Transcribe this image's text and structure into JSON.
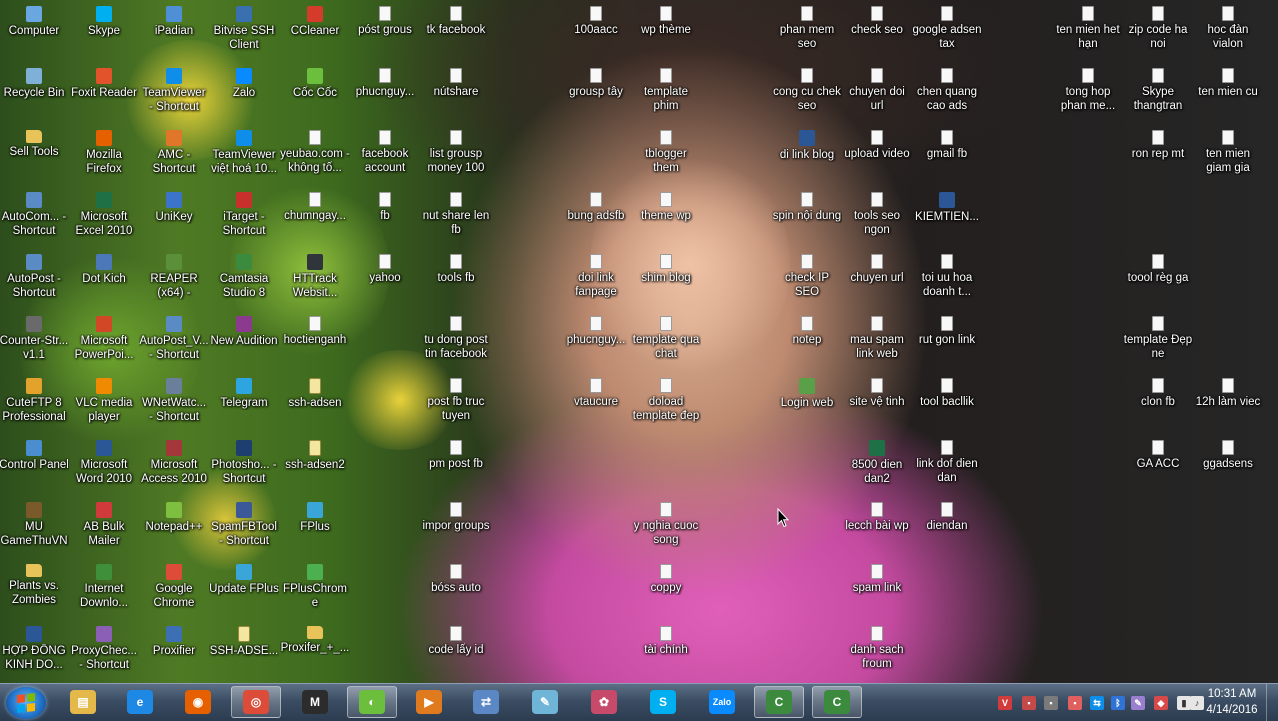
{
  "desktop_icons": [
    {
      "label": "Computer",
      "icon": "computer-icon",
      "color": "#6aa7e0"
    },
    {
      "label": "Skype",
      "icon": "skype-icon",
      "color": "#00aff0"
    },
    {
      "label": "iPadian",
      "icon": "ipadian-icon",
      "color": "#4f8fd6"
    },
    {
      "label": "Bitvise SSH Client",
      "icon": "bitvise-icon",
      "color": "#3a6fb0"
    },
    {
      "label": "CCleaner",
      "icon": "ccleaner-icon",
      "color": "#d43b2a"
    },
    {
      "label": "póst grous",
      "icon": "file-icon",
      "color": "#ffffff"
    },
    {
      "label": "tk facebook",
      "icon": "file-icon",
      "color": "#ffffff"
    },
    {
      "label": "100aacc",
      "icon": "file-icon",
      "color": "#ffffff"
    },
    {
      "label": "wp thème",
      "icon": "file-icon",
      "color": "#ffffff"
    },
    {
      "label": "phan mem seo",
      "icon": "file-icon",
      "color": "#ffffff"
    },
    {
      "label": "check seo",
      "icon": "file-icon",
      "color": "#ffffff"
    },
    {
      "label": "google adsen tax",
      "icon": "file-icon",
      "color": "#ffffff"
    },
    {
      "label": "ten mien het hạn",
      "icon": "file-icon",
      "color": "#ffffff"
    },
    {
      "label": "zip code ha noi",
      "icon": "file-icon",
      "color": "#ffffff"
    },
    {
      "label": "hoc đàn vialon",
      "icon": "file-icon",
      "color": "#ffffff"
    },
    {
      "label": "Recycle Bin",
      "icon": "recycle-bin-icon",
      "color": "#7fb0d8"
    },
    {
      "label": "Foxit Reader",
      "icon": "foxit-reader-icon",
      "color": "#e2522b"
    },
    {
      "label": "TeamViewer - Shortcut",
      "icon": "teamviewer-icon",
      "color": "#0e8ee9"
    },
    {
      "label": "Zalo",
      "icon": "zalo-icon",
      "color": "#0a8aff"
    },
    {
      "label": "Cốc Cốc",
      "icon": "coccoc-icon",
      "color": "#6bbf3c"
    },
    {
      "label": "phucnguy...",
      "icon": "file-icon",
      "color": "#ffffff"
    },
    {
      "label": "nútshare",
      "icon": "file-icon",
      "color": "#ffffff"
    },
    {
      "label": "grousp tây",
      "icon": "file-icon",
      "color": "#ffffff"
    },
    {
      "label": "template phim",
      "icon": "file-icon",
      "color": "#ffffff"
    },
    {
      "label": "cong cu chek seo",
      "icon": "file-icon",
      "color": "#ffffff"
    },
    {
      "label": "chuyen doi url",
      "icon": "file-icon",
      "color": "#ffffff"
    },
    {
      "label": "chen quang cao ads",
      "icon": "file-icon",
      "color": "#ffffff"
    },
    {
      "label": "tong hop phan me...",
      "icon": "file-icon",
      "color": "#ffffff"
    },
    {
      "label": "Skype thangtran",
      "icon": "file-icon",
      "color": "#ffffff"
    },
    {
      "label": "ten mien cu",
      "icon": "file-icon",
      "color": "#ffffff"
    },
    {
      "label": "Sell Tools",
      "icon": "folder-icon",
      "color": "#e8c35a"
    },
    {
      "label": "Mozilla Firefox",
      "icon": "firefox-icon",
      "color": "#e66000"
    },
    {
      "label": "AMC - Shortcut",
      "icon": "amc-icon",
      "color": "#e0762a"
    },
    {
      "label": "TeamViewer việt hoá 10...",
      "icon": "teamviewer-icon",
      "color": "#0e8ee9"
    },
    {
      "label": "yeubao.com - không tố...",
      "icon": "file-icon",
      "color": "#ffffff"
    },
    {
      "label": "facebook account",
      "icon": "file-icon",
      "color": "#ffffff"
    },
    {
      "label": "list grousp money 100",
      "icon": "file-icon",
      "color": "#ffffff"
    },
    {
      "label": "tblogger them",
      "icon": "file-icon",
      "color": "#ffffff"
    },
    {
      "label": "di link blog",
      "icon": "word-doc-icon",
      "color": "#2b5797"
    },
    {
      "label": "upload video",
      "icon": "file-icon",
      "color": "#ffffff"
    },
    {
      "label": "gmail fb",
      "icon": "file-icon",
      "color": "#ffffff"
    },
    {
      "label": "ron rep mt",
      "icon": "file-icon",
      "color": "#ffffff"
    },
    {
      "label": "ten mien giam gia",
      "icon": "file-icon",
      "color": "#ffffff"
    },
    {
      "label": "AutoCom... - Shortcut",
      "icon": "autocom-icon",
      "color": "#5a8bc4"
    },
    {
      "label": "Microsoft Excel 2010",
      "icon": "excel-icon",
      "color": "#1e7145"
    },
    {
      "label": "UniKey",
      "icon": "unikey-icon",
      "color": "#3c74c9"
    },
    {
      "label": "iTarget - Shortcut",
      "icon": "itarget-icon",
      "color": "#c8302c"
    },
    {
      "label": "chumngay...",
      "icon": "file-icon",
      "color": "#ffffff"
    },
    {
      "label": "fb",
      "icon": "file-icon",
      "color": "#ffffff"
    },
    {
      "label": "nut share len fb",
      "icon": "file-icon",
      "color": "#ffffff"
    },
    {
      "label": "bung adsfb",
      "icon": "file-icon",
      "color": "#ffffff"
    },
    {
      "label": "theme wp",
      "icon": "file-icon",
      "color": "#ffffff"
    },
    {
      "label": "spin nội dung",
      "icon": "file-icon",
      "color": "#ffffff"
    },
    {
      "label": "tools seo ngon",
      "icon": "file-icon",
      "color": "#ffffff"
    },
    {
      "label": "KIEMTIEN...",
      "icon": "word-doc-icon",
      "color": "#2b5797"
    },
    {
      "label": "AutoPost - Shortcut",
      "icon": "autopost-icon",
      "color": "#5a8bc4"
    },
    {
      "label": "Dot Kich",
      "icon": "dotkich-icon",
      "color": "#4c77b8"
    },
    {
      "label": "REAPER (x64) - Shortcut",
      "icon": "reaper-icon",
      "color": "#5b8f3a"
    },
    {
      "label": "Camtasia Studio 8",
      "icon": "camtasia-icon",
      "color": "#3b8a3e"
    },
    {
      "label": "HTTrack Websit...",
      "icon": "httrack-icon",
      "color": "#30353c"
    },
    {
      "label": "yahoo",
      "icon": "file-icon",
      "color": "#ffffff"
    },
    {
      "label": "tools fb",
      "icon": "file-icon",
      "color": "#ffffff"
    },
    {
      "label": "doi link fanpage",
      "icon": "file-icon",
      "color": "#ffffff"
    },
    {
      "label": "shim blog",
      "icon": "file-icon",
      "color": "#ffffff"
    },
    {
      "label": "check IP SEO",
      "icon": "file-icon",
      "color": "#ffffff"
    },
    {
      "label": "chuyen url",
      "icon": "file-icon",
      "color": "#ffffff"
    },
    {
      "label": "toi uu hoa doanh t...",
      "icon": "file-icon",
      "color": "#ffffff"
    },
    {
      "label": "toool règ ga",
      "icon": "file-icon",
      "color": "#ffffff"
    },
    {
      "label": "Counter-Str... v1.1",
      "icon": "counter-strike-icon",
      "color": "#6a6a6a"
    },
    {
      "label": "Microsoft PowerPoi...",
      "icon": "powerpoint-icon",
      "color": "#d24726"
    },
    {
      "label": "AutoPost_V... - Shortcut",
      "icon": "autopost-icon",
      "color": "#5a8bc4"
    },
    {
      "label": "New Audition",
      "icon": "audition-icon",
      "color": "#8b3a8f"
    },
    {
      "label": "hoctienganh",
      "icon": "file-icon",
      "color": "#ffffff"
    },
    {
      "label": "tu dong post tin facebook",
      "icon": "file-icon",
      "color": "#ffffff"
    },
    {
      "label": "phucnguy...",
      "icon": "file-icon",
      "color": "#ffffff"
    },
    {
      "label": "template qua chat",
      "icon": "file-icon",
      "color": "#ffffff"
    },
    {
      "label": "notep",
      "icon": "file-icon",
      "color": "#ffffff"
    },
    {
      "label": "mau spam link web",
      "icon": "file-icon",
      "color": "#ffffff"
    },
    {
      "label": "rut gon link",
      "icon": "file-icon",
      "color": "#ffffff"
    },
    {
      "label": "template Đẹp ne",
      "icon": "file-icon",
      "color": "#ffffff"
    },
    {
      "label": "CuteFTP 8 Professional",
      "icon": "cuteftp-icon",
      "color": "#e2a22c"
    },
    {
      "label": "VLC media player",
      "icon": "vlc-icon",
      "color": "#f08a00"
    },
    {
      "label": "WNetWatc... - Shortcut",
      "icon": "wnetwatcher-icon",
      "color": "#6a7f99"
    },
    {
      "label": "Telegram",
      "icon": "telegram-icon",
      "color": "#2ca5e0"
    },
    {
      "label": "ssh-adsen",
      "icon": "text-file-icon",
      "color": "#f2e6a0"
    },
    {
      "label": "post fb truc tuyen",
      "icon": "file-icon",
      "color": "#ffffff"
    },
    {
      "label": "vtaucure",
      "icon": "file-icon",
      "color": "#ffffff"
    },
    {
      "label": "doload template đep",
      "icon": "file-icon",
      "color": "#ffffff"
    },
    {
      "label": "Login web",
      "icon": "login-web-icon",
      "color": "#5aa048"
    },
    {
      "label": "site vệ tinh",
      "icon": "file-icon",
      "color": "#ffffff"
    },
    {
      "label": "tool bacllik",
      "icon": "file-icon",
      "color": "#ffffff"
    },
    {
      "label": "clon fb",
      "icon": "file-icon",
      "color": "#ffffff"
    },
    {
      "label": "12h làm viec",
      "icon": "file-icon",
      "color": "#ffffff"
    },
    {
      "label": "Control Panel",
      "icon": "control-panel-icon",
      "color": "#4a8ed0"
    },
    {
      "label": "Microsoft Word 2010",
      "icon": "word-icon",
      "color": "#2b5797"
    },
    {
      "label": "Microsoft Access 2010",
      "icon": "access-icon",
      "color": "#a4373a"
    },
    {
      "label": "Photosho... - Shortcut",
      "icon": "photoshop-icon",
      "color": "#1c3f70"
    },
    {
      "label": "ssh-adsen2",
      "icon": "text-file-icon",
      "color": "#f2e6a0"
    },
    {
      "label": "pm post fb",
      "icon": "file-icon",
      "color": "#ffffff"
    },
    {
      "label": "8500 dien dan2",
      "icon": "excel-file-icon",
      "color": "#1e7145"
    },
    {
      "label": "link dof dien dan",
      "icon": "file-icon",
      "color": "#ffffff"
    },
    {
      "label": "GA ACC",
      "icon": "file-icon",
      "color": "#ffffff"
    },
    {
      "label": "ggadsens",
      "icon": "file-icon",
      "color": "#ffffff"
    },
    {
      "label": "MU GameThuVN",
      "icon": "mu-game-icon",
      "color": "#7a5a2a"
    },
    {
      "label": "AB Bulk Mailer",
      "icon": "bulk-mailer-icon",
      "color": "#d13a3a"
    },
    {
      "label": "Notepad++",
      "icon": "notepadpp-icon",
      "color": "#7fbf3f"
    },
    {
      "label": "SpamFBTool - Shortcut",
      "icon": "spamfbtool-icon",
      "color": "#3b5998"
    },
    {
      "label": "FPlus",
      "icon": "fplus-icon",
      "color": "#3aa5d8"
    },
    {
      "label": "impor groups",
      "icon": "file-icon",
      "color": "#ffffff"
    },
    {
      "label": "y nghia cuoc song",
      "icon": "file-icon",
      "color": "#ffffff"
    },
    {
      "label": "lecch bài wp",
      "icon": "file-icon",
      "color": "#ffffff"
    },
    {
      "label": "diendan",
      "icon": "file-icon",
      "color": "#ffffff"
    },
    {
      "label": "Plants vs. Zombies",
      "icon": "folder-icon",
      "color": "#e8c35a"
    },
    {
      "label": "Internet Downlo...",
      "icon": "idm-icon",
      "color": "#3f8f3a"
    },
    {
      "label": "Google Chrome",
      "icon": "chrome-icon",
      "color": "#dd4b39"
    },
    {
      "label": "Update FPlus",
      "icon": "update-fplus-icon",
      "color": "#3aa5d8"
    },
    {
      "label": "FPlusChrome",
      "icon": "fpluschrome-icon",
      "color": "#4caf50"
    },
    {
      "label": "bóss auto",
      "icon": "file-icon",
      "color": "#ffffff"
    },
    {
      "label": "coppy",
      "icon": "file-icon",
      "color": "#ffffff"
    },
    {
      "label": "spam link",
      "icon": "file-icon",
      "color": "#ffffff"
    },
    {
      "label": "HỢP ĐỒNG KINH DO...",
      "icon": "word-doc-icon",
      "color": "#2b5797"
    },
    {
      "label": "ProxyChec... - Shortcut",
      "icon": "proxychecker-icon",
      "color": "#8a5fb5"
    },
    {
      "label": "Proxifier",
      "icon": "proxifier-icon",
      "color": "#3c6fb3"
    },
    {
      "label": "SSH-ADSE...",
      "icon": "text-file-icon",
      "color": "#f2e6a0"
    },
    {
      "label": "Proxifer_+_...",
      "icon": "folder-icon",
      "color": "#e8c35a"
    },
    {
      "label": "code lấy id",
      "icon": "file-icon",
      "color": "#ffffff"
    },
    {
      "label": "tài chính",
      "icon": "file-icon",
      "color": "#ffffff"
    },
    {
      "label": "danh sach froum",
      "icon": "file-icon",
      "color": "#ffffff"
    }
  ],
  "taskbar": {
    "start_label": "Start",
    "items": [
      {
        "name": "windows-explorer",
        "icon": "folder-icon",
        "color": "#e5b84a",
        "glyph": "▤",
        "active": false
      },
      {
        "name": "internet-explorer",
        "icon": "internet-explorer-icon",
        "color": "#1e88e5",
        "glyph": "e",
        "active": false
      },
      {
        "name": "firefox",
        "icon": "firefox-icon",
        "color": "#e66000",
        "glyph": "◉",
        "active": false
      },
      {
        "name": "chrome",
        "icon": "chrome-icon",
        "color": "#dd4b39",
        "glyph": "◎",
        "active": true
      },
      {
        "name": "mu-game",
        "icon": "mu-game-icon",
        "color": "#2c2c2c",
        "glyph": "M",
        "active": false
      },
      {
        "name": "coccoc",
        "icon": "coccoc-icon",
        "color": "#6bbf3c",
        "glyph": "◐",
        "active": true
      },
      {
        "name": "media-player",
        "icon": "media-player-icon",
        "color": "#e07a1f",
        "glyph": "▶",
        "active": false
      },
      {
        "name": "network-tool",
        "icon": "network-icon",
        "color": "#5b87c4",
        "glyph": "⇄",
        "active": false
      },
      {
        "name": "notepad",
        "icon": "notepad-icon",
        "color": "#6fb5d8",
        "glyph": "✎",
        "active": false
      },
      {
        "name": "paint",
        "icon": "paint-icon",
        "color": "#c84a6a",
        "glyph": "✿",
        "active": false
      },
      {
        "name": "skype",
        "icon": "skype-icon",
        "color": "#00aff0",
        "glyph": "S",
        "active": false
      },
      {
        "name": "zalo",
        "icon": "zalo-icon",
        "color": "#0a8aff",
        "glyph": "Zalo",
        "active": false
      },
      {
        "name": "camtasia-1",
        "icon": "camtasia-icon",
        "color": "#3b8a3e",
        "glyph": "C",
        "active": true
      },
      {
        "name": "camtasia-2",
        "icon": "camtasia-icon",
        "color": "#3b8a3e",
        "glyph": "C",
        "active": true
      }
    ],
    "tray": [
      {
        "name": "unikey-tray",
        "icon": "unikey-tray-icon",
        "color": "#d23b3b",
        "glyph": "V"
      },
      {
        "name": "tray-1",
        "icon": "app-tray-icon",
        "color": "#c44a4a",
        "glyph": "▪"
      },
      {
        "name": "tray-2",
        "icon": "app-tray-icon",
        "color": "#7a7a7a",
        "glyph": "▪"
      },
      {
        "name": "tray-3",
        "icon": "app-tray-icon",
        "color": "#e06060",
        "glyph": "▪"
      },
      {
        "name": "teamviewer-tray",
        "icon": "teamviewer-tray-icon",
        "color": "#0e8ee9",
        "glyph": "⇆"
      },
      {
        "name": "bluetooth-tray",
        "icon": "bluetooth-icon",
        "color": "#2f73d6",
        "glyph": "ᛒ"
      },
      {
        "name": "pen-tray",
        "icon": "pen-tray-icon",
        "color": "#9a7fd1",
        "glyph": "✎"
      },
      {
        "name": "security-tray",
        "icon": "security-icon",
        "color": "#d84a4a",
        "glyph": "◆"
      },
      {
        "name": "network-tray",
        "icon": "network-signal-icon",
        "color": "#e6e6e6",
        "glyph": "▮"
      },
      {
        "name": "volume-tray",
        "icon": "volume-icon",
        "color": "#e6e6e6",
        "glyph": "♪"
      }
    ],
    "clock_time": "10:31 AM",
    "clock_date": "4/14/2016"
  }
}
